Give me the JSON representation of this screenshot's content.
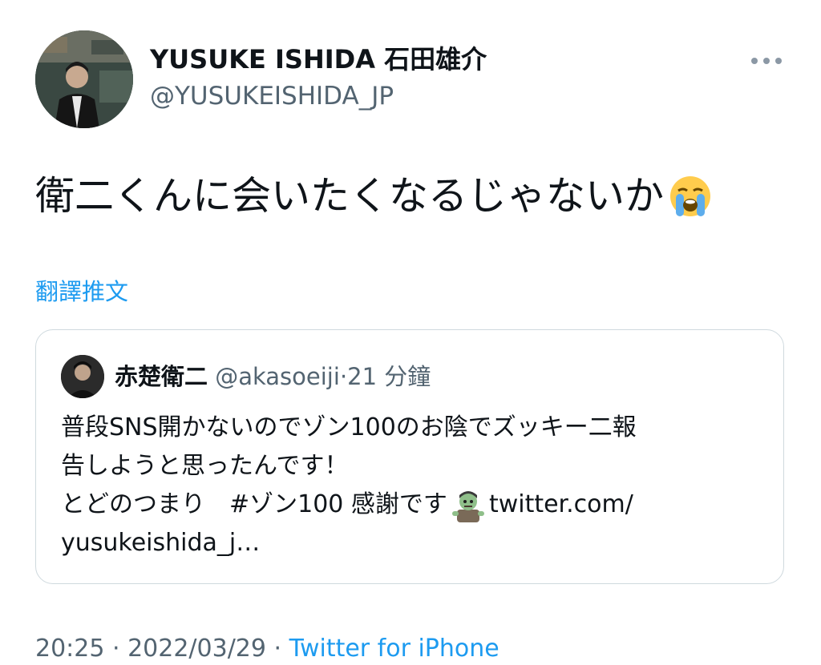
{
  "tweet": {
    "author": {
      "display_name": "YUSUKE ISHIDA 石田雄介",
      "handle": "@YUSUKEISHIDA_JP",
      "avatar_icon": "profile-photo"
    },
    "more_icon": "more-horizontal-icon",
    "text": "衛二くんに会いたくなるじゃないか",
    "text_emoji": "loudly-crying-face-emoji",
    "translate_label": "翻譯推文"
  },
  "quote": {
    "display_name": "赤楚衛二",
    "handle": "@akasoeiji",
    "separator": "·",
    "time": "21 分鐘",
    "lines": [
      "普段SNS開かないのでゾン100のお陰でズッキー二報",
      "告しようと思ったんです！",
      "とどのつまり　#ゾン100 感謝です",
      "yusukeishida_j…"
    ],
    "emoji": "zombie-emoji",
    "link_text": " twitter.com/"
  },
  "footer": {
    "time_text": "20:25 · 2022/03/29 · ",
    "source_text": "Twitter for iPhone"
  },
  "colors": {
    "text_primary": "#0f1419",
    "text_secondary": "#536471",
    "link_blue": "#1d9bf0",
    "border": "#cfd9de"
  }
}
